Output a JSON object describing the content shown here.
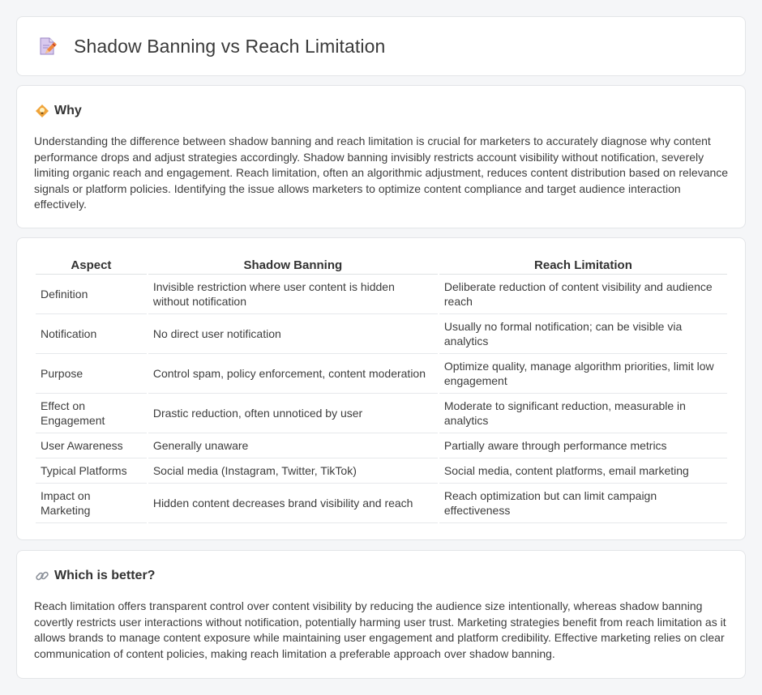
{
  "header": {
    "title": "Shadow Banning vs Reach Limitation",
    "icon": "document-pencil-icon"
  },
  "why": {
    "heading": "Why",
    "icon": "diamond-bulb-icon",
    "text": "Understanding the difference between shadow banning and reach limitation is crucial for marketers to accurately diagnose why content performance drops and adjust strategies accordingly. Shadow banning invisibly restricts account visibility without notification, severely limiting organic reach and engagement. Reach limitation, often an algorithmic adjustment, reduces content distribution based on relevance signals or platform policies. Identifying the issue allows marketers to optimize content compliance and target audience interaction effectively."
  },
  "comparison": {
    "headers": [
      "Aspect",
      "Shadow Banning",
      "Reach Limitation"
    ],
    "rows": [
      {
        "aspect": "Definition",
        "a": "Invisible restriction where user content is hidden without notification",
        "b": "Deliberate reduction of content visibility and audience reach"
      },
      {
        "aspect": "Notification",
        "a": "No direct user notification",
        "b": "Usually no formal notification; can be visible via analytics"
      },
      {
        "aspect": "Purpose",
        "a": "Control spam, policy enforcement, content moderation",
        "b": "Optimize quality, manage algorithm priorities, limit low engagement"
      },
      {
        "aspect": "Effect on Engagement",
        "a": "Drastic reduction, often unnoticed by user",
        "b": "Moderate to significant reduction, measurable in analytics"
      },
      {
        "aspect": "User Awareness",
        "a": "Generally unaware",
        "b": "Partially aware through performance metrics"
      },
      {
        "aspect": "Typical Platforms",
        "a": "Social media (Instagram, Twitter, TikTok)",
        "b": "Social media, content platforms, email marketing"
      },
      {
        "aspect": "Impact on Marketing",
        "a": "Hidden content decreases brand visibility and reach",
        "b": "Reach optimization but can limit campaign effectiveness"
      }
    ]
  },
  "which": {
    "heading": "Which is better?",
    "icon": "link-icon",
    "text": "Reach limitation offers transparent control over content visibility by reducing the audience size intentionally, whereas shadow banning covertly restricts user interactions without notification, potentially harming user trust. Marketing strategies benefit from reach limitation as it allows brands to manage content exposure while maintaining user engagement and platform credibility. Effective marketing relies on clear communication of content policies, making reach limitation a preferable approach over shadow banning."
  }
}
